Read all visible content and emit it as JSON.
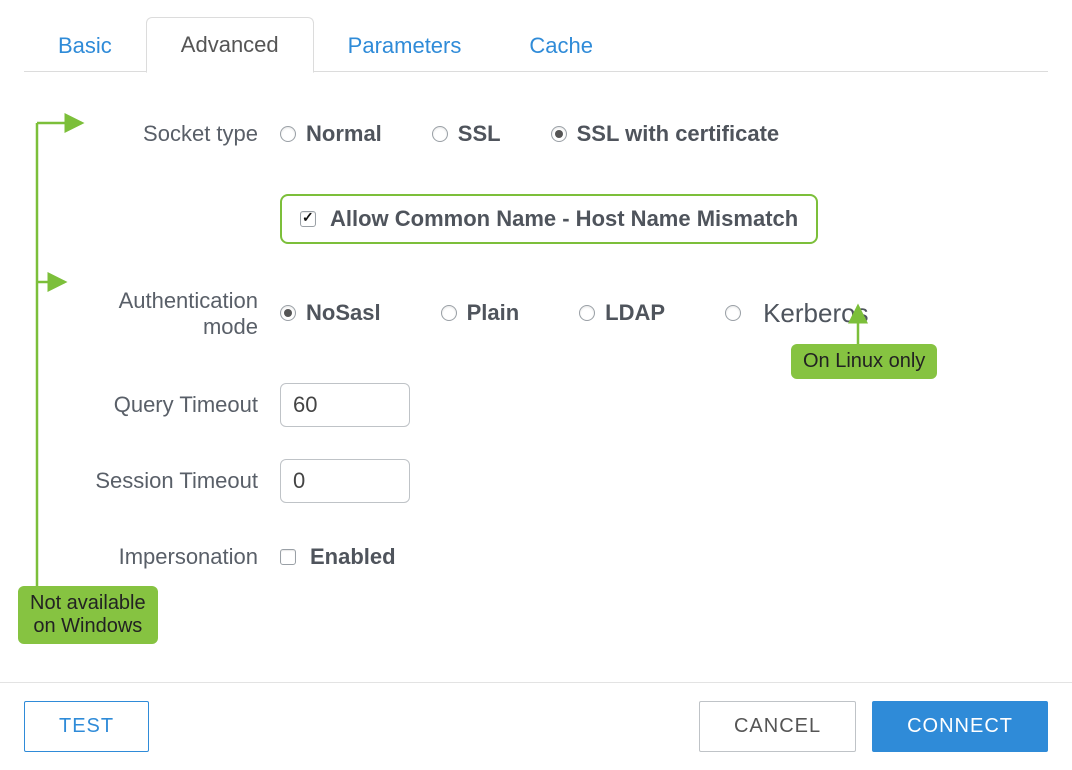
{
  "tabs": {
    "basic": "Basic",
    "advanced": "Advanced",
    "parameters": "Parameters",
    "cache": "Cache",
    "active": "advanced"
  },
  "labels": {
    "socket_type": "Socket type",
    "auth_mode_line1": "Authentication",
    "auth_mode_line2": "mode",
    "query_timeout": "Query Timeout",
    "session_timeout": "Session Timeout",
    "impersonation": "Impersonation"
  },
  "socket": {
    "normal": "Normal",
    "ssl": "SSL",
    "ssl_cert": "SSL with certificate",
    "selected": "ssl_cert",
    "allow_cn": "Allow Common Name - Host Name Mismatch",
    "allow_cn_checked": true
  },
  "auth": {
    "nosasl": "NoSasl",
    "plain": "Plain",
    "ldap": "LDAP",
    "kerberos": "Kerberos",
    "selected": "nosasl"
  },
  "values": {
    "query_timeout": "60",
    "session_timeout": "0"
  },
  "impersonation": {
    "enabled_label": "Enabled",
    "checked": false
  },
  "annotations": {
    "not_avail_line1": "Not available",
    "not_avail_line2": "on Windows",
    "linux_only": "On Linux only"
  },
  "buttons": {
    "test": "TEST",
    "cancel": "CANCEL",
    "connect": "CONNECT"
  },
  "colors": {
    "accent_blue": "#2f8bd8",
    "annotation_green": "#86c341",
    "highlight_green": "#7cbf3a",
    "text": "#555c66"
  }
}
